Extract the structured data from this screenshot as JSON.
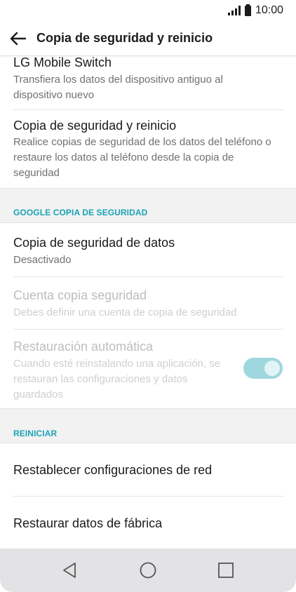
{
  "status_bar": {
    "time": "10:00",
    "signal_icon": "signal-bars-icon",
    "battery_icon": "battery-icon"
  },
  "header": {
    "back_icon": "arrow-left-icon",
    "title": "Copia de seguridad y reinicio"
  },
  "items_top": [
    {
      "title": "LG Mobile Switch",
      "subtitle": "Transfiera los datos del dispositivo antiguo al dispositivo nuevo"
    },
    {
      "title": "Copia de seguridad y reinicio",
      "subtitle": "Realice copias de seguridad de los datos del teléfono o restaure los datos al teléfono desde la copia de seguridad"
    }
  ],
  "google_section": {
    "label": "GOOGLE COPIA DE SEGURIDAD",
    "items": [
      {
        "title": "Copia de seguridad de datos",
        "subtitle": "Desactivado"
      },
      {
        "title": "Cuenta copia seguridad",
        "subtitle": "Debes definir una cuenta de copia de seguridad"
      },
      {
        "title": "Restauración automática",
        "subtitle": "Cuando esté reinstalando una aplicación, se restauran las configuraciones y datos guardados",
        "toggle_on": true
      }
    ]
  },
  "reset_section": {
    "label": "REINICIAR",
    "items": [
      {
        "title": "Restablecer configuraciones de red"
      },
      {
        "title": "Restaurar datos de fábrica"
      }
    ]
  },
  "nav_bar": {
    "back_icon": "triangle-back-icon",
    "home_icon": "circle-home-icon",
    "recents_icon": "square-recents-icon"
  },
  "colors": {
    "accent": "#1aa3b5",
    "toggle_track": "#9ed7dd",
    "section_bg": "#f2f2f2"
  }
}
